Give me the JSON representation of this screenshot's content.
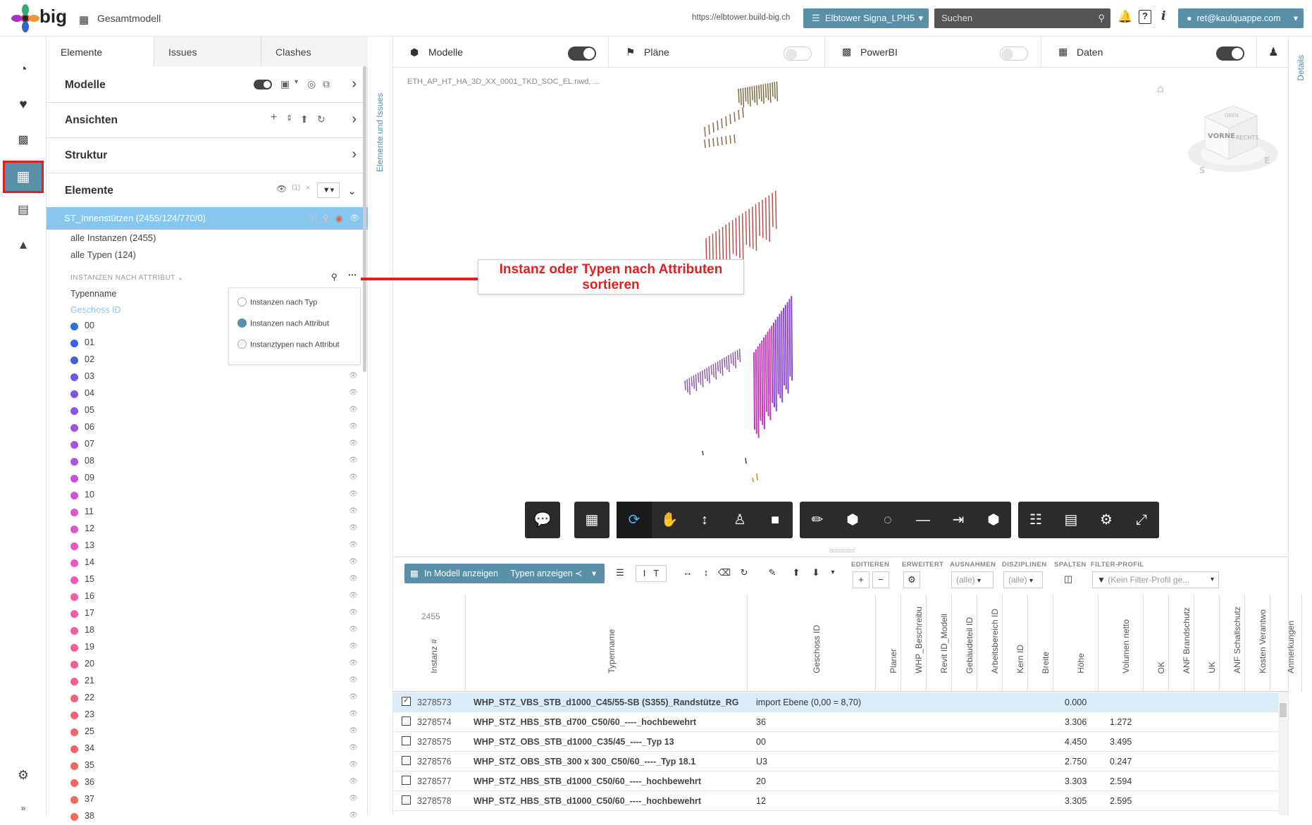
{
  "header": {
    "logo_text": "big",
    "app_title": "Gesamtmodell",
    "url": "https://elbtower.build-big.ch",
    "project": "Elbtower Signa_LPH5",
    "search_placeholder": "Suchen",
    "help": "?",
    "info": "i",
    "user": "ret@kaulquappe.com"
  },
  "rail": [
    "dashboard-icon",
    "heart-icon",
    "chart-icon",
    "grid-icon",
    "document-icon",
    "report-icon",
    "settings-icon",
    "expand-icon"
  ],
  "panel": {
    "tabs": [
      "Elemente",
      "Issues",
      "Clashes"
    ],
    "sections": {
      "modelle": "Modelle",
      "ansichten": "Ansichten",
      "struktur": "Struktur",
      "elemente": "Elemente"
    },
    "filter_count": "(1)",
    "selected_row": "ST_Innenstützen (2455/124/770/0)",
    "alle_instanzen": "alle Instanzen (2455)",
    "alle_typen": "alle Typen (124)",
    "instanzen_hdr": "INSTANZEN NACH ATTRIBUT",
    "typenname": "Typenname",
    "geschoss": "Geschoss ID",
    "attributes": [
      {
        "label": "00",
        "color": "#2f6fe0"
      },
      {
        "label": "01",
        "color": "#3a62e2"
      },
      {
        "label": "02",
        "color": "#4b5be3"
      },
      {
        "label": "03",
        "color": "#6a5ae3"
      },
      {
        "label": "04",
        "color": "#7d57e2"
      },
      {
        "label": "05",
        "color": "#8c56e1"
      },
      {
        "label": "06",
        "color": "#9a55e0"
      },
      {
        "label": "07",
        "color": "#a854df"
      },
      {
        "label": "08",
        "color": "#b653de"
      },
      {
        "label": "09",
        "color": "#c453dc"
      },
      {
        "label": "10",
        "color": "#cf54d8"
      },
      {
        "label": "11",
        "color": "#d855d3"
      },
      {
        "label": "12",
        "color": "#e056cc"
      },
      {
        "label": "13",
        "color": "#e657c4"
      },
      {
        "label": "14",
        "color": "#ea58bc"
      },
      {
        "label": "15",
        "color": "#ed59b4"
      },
      {
        "label": "16",
        "color": "#ef5aac"
      },
      {
        "label": "17",
        "color": "#f05ba4"
      },
      {
        "label": "18",
        "color": "#f15c9c"
      },
      {
        "label": "19",
        "color": "#f25d94"
      },
      {
        "label": "20",
        "color": "#f25e8c"
      },
      {
        "label": "21",
        "color": "#f25f85"
      },
      {
        "label": "22",
        "color": "#f2607e"
      },
      {
        "label": "23",
        "color": "#f26177"
      },
      {
        "label": "25",
        "color": "#f26270"
      },
      {
        "label": "34",
        "color": "#f26369"
      },
      {
        "label": "35",
        "color": "#f26462"
      },
      {
        "label": "36",
        "color": "#f2665c"
      },
      {
        "label": "37",
        "color": "#f26856"
      },
      {
        "label": "38",
        "color": "#f26a50"
      }
    ],
    "popup": [
      "Instanzen nach Typ",
      "Instanzen nach Attribut",
      "Instanztypen nach Attribut"
    ],
    "popup_selected": 1
  },
  "vtab_label": "Elemente und Issues",
  "right_vtab": "Details",
  "viewer": {
    "columns": [
      {
        "label": "Modelle",
        "toggle": "on"
      },
      {
        "label": "Pläne",
        "toggle": "off"
      },
      {
        "label": "PowerBI",
        "toggle": "off"
      },
      {
        "label": "Daten",
        "toggle": "on"
      }
    ],
    "filename": "ETH_AP_HT_HA_3D_XX_0001_TKD_SOC_EL.nwd, ...",
    "annotation": "Instanz oder Typen nach Attributen sortieren",
    "cube_front": "VORNE",
    "cube_right": "RECHTS",
    "cube_top": "OBEN",
    "cube_e": "E",
    "cube_s": "S"
  },
  "table": {
    "show_in_model": "In Modell anzeigen",
    "show_types": "Typen anzeigen",
    "labels": {
      "editieren": "EDITIEREN",
      "erweitert": "ERWEITERT",
      "ausnahmen": "AUSNAHMEN",
      "disziplinen": "DISZIPLINEN",
      "spalten": "SPALTEN",
      "filter_profil": "FILTER-PROFIL"
    },
    "ausnahmen_val": "(alle)",
    "disziplinen_val": "(alle)",
    "filter_placeholder": "(Kein Filter-Profil ge...",
    "count": "2455",
    "headers": [
      "Instanz #",
      "Typenname",
      "Geschoss ID",
      "Planer",
      "WHP_Beschreibu",
      "Revit ID_Modell",
      "Gebäudeteil ID",
      "Arbeitsbereich ID",
      "Kern ID",
      "Breite",
      "Höhe",
      "Volumen netto",
      "OK",
      "ANF Brandschutz",
      "UK",
      "ANF Schallschutz",
      "Kosten Verantwo",
      "Anmerkungen"
    ],
    "rows": [
      {
        "id": "3278573",
        "name": "WHP_STZ_VBS_STB_d1000_C45/55-SB (S355)_Randstütze_RG",
        "geschoss": "import Ebene (0,00 = 8,70)",
        "hoehe": "0.000",
        "volumen": "",
        "checked": true
      },
      {
        "id": "3278574",
        "name": "WHP_STZ_HBS_STB_d700_C50/60_----_hochbewehrt",
        "geschoss": "36",
        "hoehe": "3.306",
        "volumen": "1.272",
        "checked": false
      },
      {
        "id": "3278575",
        "name": "WHP_STZ_OBS_STB_d1000_C35/45_----_Typ 13",
        "geschoss": "00",
        "hoehe": "4.450",
        "volumen": "3.495",
        "checked": false
      },
      {
        "id": "3278576",
        "name": "WHP_STZ_OBS_STB_300 x 300_C50/60_----_Typ 18.1",
        "geschoss": "U3",
        "hoehe": "2.750",
        "volumen": "0.247",
        "checked": false
      },
      {
        "id": "3278577",
        "name": "WHP_STZ_HBS_STB_d1000_C50/60_----_hochbewehrt",
        "geschoss": "20",
        "hoehe": "3.303",
        "volumen": "2.594",
        "checked": false
      },
      {
        "id": "3278578",
        "name": "WHP_STZ_HBS_STB_d1000_C50/60_----_hochbewehrt",
        "geschoss": "12",
        "hoehe": "3.305",
        "volumen": "2.595",
        "checked": false
      }
    ]
  },
  "colors": {
    "accent": "#5a8fa8",
    "selection": "#88c6ee",
    "annotation": "#e02020",
    "toolbar": "#2b2b2b"
  }
}
